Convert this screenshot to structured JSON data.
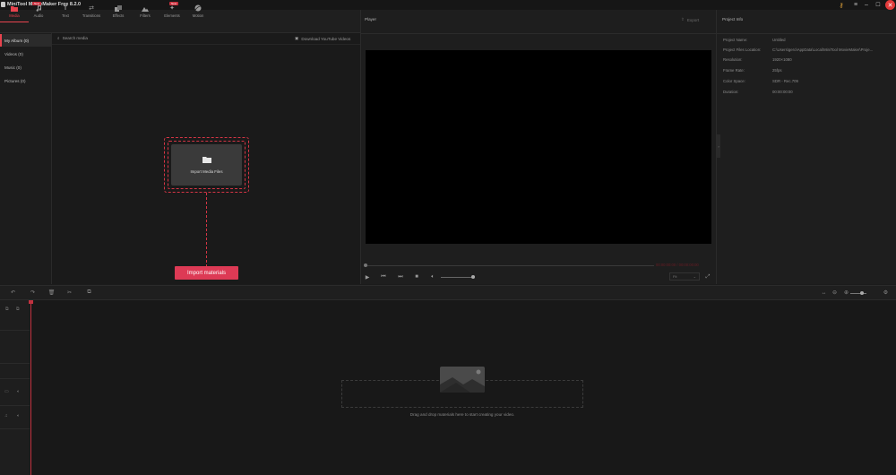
{
  "app": {
    "title": "MiniTool MovieMaker Free 8.2.0"
  },
  "toolbar": {
    "tabs": [
      {
        "label": "Media",
        "icon": "folder-icon",
        "active": true
      },
      {
        "label": "Audio",
        "icon": "music-icon",
        "badge": "New"
      },
      {
        "label": "Text",
        "icon": "text-icon"
      },
      {
        "label": "Transitions",
        "icon": "transitions-icon"
      },
      {
        "label": "Effects",
        "icon": "effects-icon"
      },
      {
        "label": "Filters",
        "icon": "filters-icon"
      },
      {
        "label": "Elements",
        "icon": "elements-icon",
        "badge": "New"
      },
      {
        "label": "Motion",
        "icon": "motion-icon"
      }
    ]
  },
  "albums": [
    {
      "label": "My Album (0)",
      "active": true
    },
    {
      "label": "Videos (0)"
    },
    {
      "label": "Music (0)"
    },
    {
      "label": "Pictures (0)"
    }
  ],
  "media": {
    "search_placeholder": "Search media",
    "youtube_link": "Download YouTube Videos",
    "import_box_label": "Import Media Files",
    "import_button": "Import materials"
  },
  "player": {
    "title": "Player",
    "export_label": "Export",
    "timecode": "00:00:00:00 / 00:00:00:00",
    "fit": "Fit"
  },
  "project_info": {
    "title": "Project Info",
    "rows": [
      {
        "key": "Project Name:",
        "value": "Untitled"
      },
      {
        "key": "Project Files Location:",
        "value": "C:\\Users\\gero\\AppData\\Local\\MiniTool MovieMaker\\Proje..."
      },
      {
        "key": "Resolution:",
        "value": "1920×1080"
      },
      {
        "key": "Frame Rate:",
        "value": "25fps"
      },
      {
        "key": "Color Space:",
        "value": "SDR - Rec.709"
      },
      {
        "key": "Duration:",
        "value": "00:00:00:00"
      }
    ]
  },
  "timeline": {
    "drop_text": "Drag and drop materials here to start creating your video."
  },
  "colors": {
    "accent": "#e8434e",
    "button": "#dd3a55",
    "background": "#1b1b1b"
  }
}
